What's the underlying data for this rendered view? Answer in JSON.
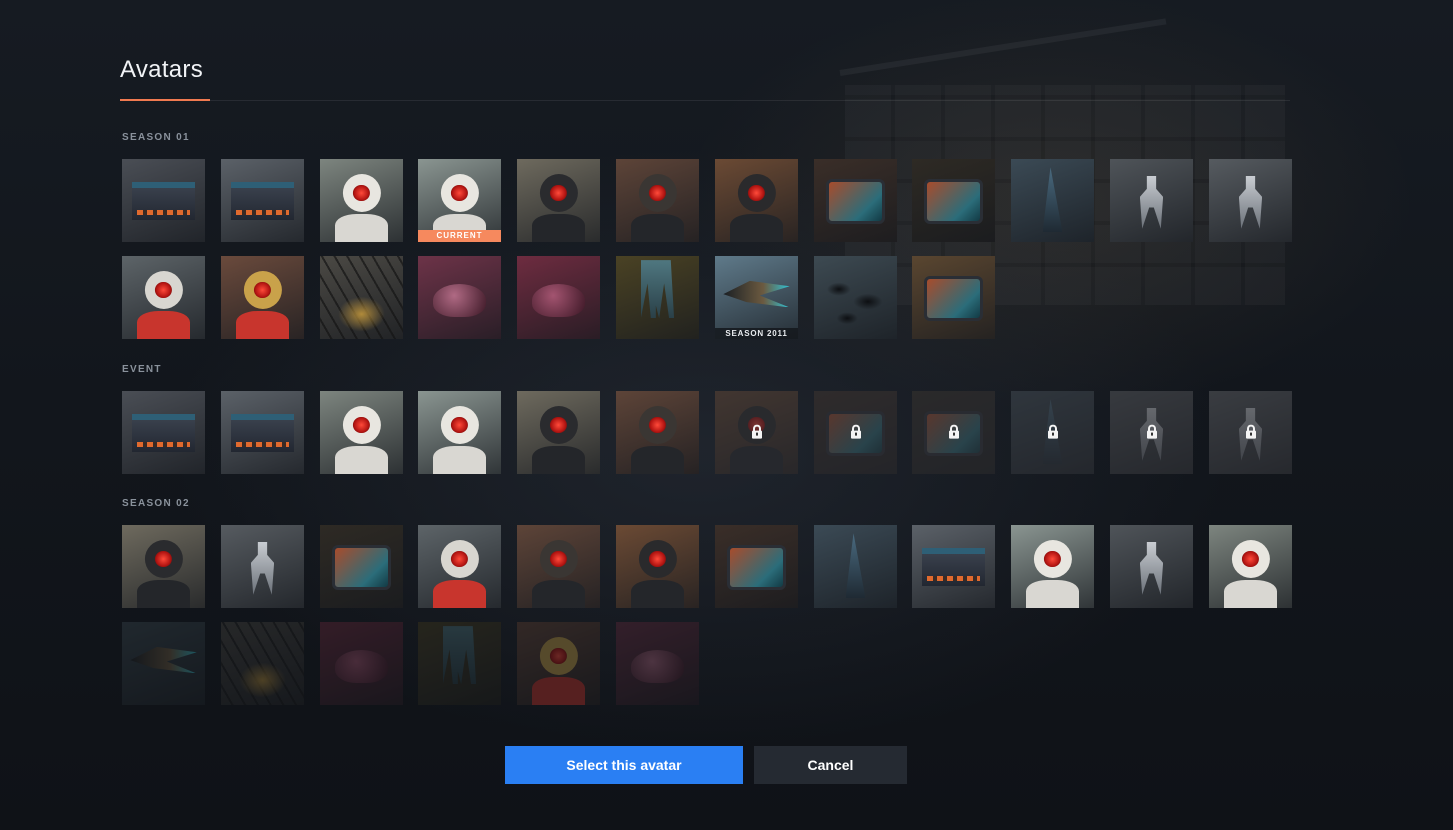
{
  "header": {
    "title": "Avatars"
  },
  "sections": {
    "season01": {
      "label": "SEASON 01",
      "current_badge": "CURRENT",
      "season_badge": "SEASON 2011"
    },
    "event": {
      "label": "EVENT"
    },
    "season02": {
      "label": "SEASON 02"
    }
  },
  "tiles": [
    {
      "section": "season01",
      "kind": "cube",
      "bg": "#4a4e55",
      "state": "normal"
    },
    {
      "section": "season01",
      "kind": "cube",
      "bg": "#5b6168",
      "state": "normal"
    },
    {
      "section": "season01",
      "kind": "astro",
      "bg": "#7d857f",
      "accent": "#e8e6e0",
      "state": "normal"
    },
    {
      "section": "season01",
      "kind": "astro",
      "bg": "#8a9591",
      "accent": "#e8e6e0",
      "state": "current"
    },
    {
      "section": "season01",
      "kind": "robot",
      "bg": "#6e6a5e",
      "accent": "#2a2b2e",
      "state": "normal"
    },
    {
      "section": "season01",
      "kind": "robot",
      "bg": "#5d4438",
      "accent": "#3a3633",
      "state": "normal"
    },
    {
      "section": "season01",
      "kind": "robot",
      "bg": "#6b4a34",
      "accent": "#2a2a2c",
      "state": "normal"
    },
    {
      "section": "season01",
      "kind": "screen",
      "bg": "#3a2e28",
      "state": "normal"
    },
    {
      "section": "season01",
      "kind": "screen",
      "bg": "#2e2a24",
      "state": "normal"
    },
    {
      "section": "season01",
      "kind": "tower",
      "bg": "#3b4a55",
      "state": "normal"
    },
    {
      "section": "season01",
      "kind": "bot",
      "bg": "#4f5459",
      "state": "normal"
    },
    {
      "section": "season01",
      "kind": "bot",
      "bg": "#565b60",
      "state": "normal"
    },
    {
      "section": "season01",
      "kind": "astro-red",
      "bg": "#5d6468",
      "accent": "#d8d6d0",
      "state": "normal"
    },
    {
      "section": "season01",
      "kind": "astro-red",
      "bg": "#6a4a3c",
      "accent": "#c9a24a",
      "state": "normal"
    },
    {
      "section": "season01",
      "kind": "wires",
      "bg": "#4b4944",
      "state": "normal"
    },
    {
      "section": "season01",
      "kind": "blob",
      "bg": "#6d3348",
      "accent": "#b06a84",
      "state": "normal"
    },
    {
      "section": "season01",
      "kind": "blob",
      "bg": "#6e2c40",
      "accent": "#a35470",
      "state": "normal"
    },
    {
      "section": "season01",
      "kind": "legs",
      "bg": "#4a4224",
      "state": "normal"
    },
    {
      "section": "season01",
      "kind": "bird",
      "bg": "#5f7a8a",
      "state": "season"
    },
    {
      "section": "season01",
      "kind": "rocks",
      "bg": "#3d4a52",
      "state": "normal"
    },
    {
      "section": "season01",
      "kind": "screen",
      "bg": "#5a4630",
      "state": "normal"
    },
    {
      "section": "event",
      "kind": "cube",
      "bg": "#4a4e55",
      "state": "normal"
    },
    {
      "section": "event",
      "kind": "cube",
      "bg": "#5b6168",
      "state": "normal"
    },
    {
      "section": "event",
      "kind": "astro",
      "bg": "#7d857f",
      "accent": "#e8e6e0",
      "state": "normal"
    },
    {
      "section": "event",
      "kind": "astro",
      "bg": "#8a9591",
      "accent": "#e8e6e0",
      "state": "normal"
    },
    {
      "section": "event",
      "kind": "robot",
      "bg": "#6e6a5e",
      "accent": "#2a2b2e",
      "state": "normal"
    },
    {
      "section": "event",
      "kind": "robot",
      "bg": "#5d4438",
      "accent": "#3a3633",
      "state": "normal"
    },
    {
      "section": "event",
      "kind": "robot",
      "bg": "#6b4a34",
      "accent": "#2a2a2c",
      "state": "locked"
    },
    {
      "section": "event",
      "kind": "screen",
      "bg": "#3a2e28",
      "state": "locked"
    },
    {
      "section": "event",
      "kind": "screen",
      "bg": "#2e2a24",
      "state": "locked"
    },
    {
      "section": "event",
      "kind": "tower",
      "bg": "#3b4a55",
      "state": "locked"
    },
    {
      "section": "event",
      "kind": "bot",
      "bg": "#4f5459",
      "state": "locked"
    },
    {
      "section": "event",
      "kind": "bot",
      "bg": "#565b60",
      "state": "locked"
    },
    {
      "section": "season02",
      "kind": "robot",
      "bg": "#6e6a5e",
      "accent": "#2a2b2e",
      "state": "normal"
    },
    {
      "section": "season02",
      "kind": "bot",
      "bg": "#565b60",
      "state": "normal"
    },
    {
      "section": "season02",
      "kind": "screen",
      "bg": "#2e2a24",
      "state": "normal"
    },
    {
      "section": "season02",
      "kind": "astro-red",
      "bg": "#5d6468",
      "accent": "#d8d6d0",
      "state": "normal"
    },
    {
      "section": "season02",
      "kind": "robot",
      "bg": "#5d4438",
      "accent": "#3a3633",
      "state": "normal"
    },
    {
      "section": "season02",
      "kind": "robot",
      "bg": "#6b4a34",
      "accent": "#2a2a2c",
      "state": "normal"
    },
    {
      "section": "season02",
      "kind": "screen",
      "bg": "#3a2e28",
      "state": "normal"
    },
    {
      "section": "season02",
      "kind": "tower",
      "bg": "#3b4a55",
      "state": "normal"
    },
    {
      "section": "season02",
      "kind": "cube",
      "bg": "#5b6168",
      "state": "normal"
    },
    {
      "section": "season02",
      "kind": "astro",
      "bg": "#8a9591",
      "accent": "#e8e6e0",
      "state": "normal"
    },
    {
      "section": "season02",
      "kind": "bot",
      "bg": "#4f5459",
      "state": "normal"
    },
    {
      "section": "season02",
      "kind": "astro",
      "bg": "#7d857f",
      "accent": "#e8e6e0",
      "state": "normal"
    },
    {
      "section": "season02",
      "kind": "bird",
      "bg": "#3b4a52",
      "state": "faded"
    },
    {
      "section": "season02",
      "kind": "wires",
      "bg": "#4b4944",
      "state": "faded"
    },
    {
      "section": "season02",
      "kind": "blob",
      "bg": "#6e2c40",
      "accent": "#a35470",
      "state": "faded"
    },
    {
      "section": "season02",
      "kind": "legs",
      "bg": "#4a4224",
      "state": "faded"
    },
    {
      "section": "season02",
      "kind": "astro-red",
      "bg": "#6a4a3c",
      "accent": "#c9a24a",
      "state": "faded"
    },
    {
      "section": "season02",
      "kind": "blob",
      "bg": "#6d3348",
      "accent": "#b06a84",
      "state": "faded"
    }
  ],
  "footer": {
    "select_label": "Select this avatar",
    "cancel_label": "Cancel"
  },
  "colors": {
    "accent": "#f6895e",
    "primary_button": "#2a7ff3",
    "secondary_button": "#252a32"
  }
}
